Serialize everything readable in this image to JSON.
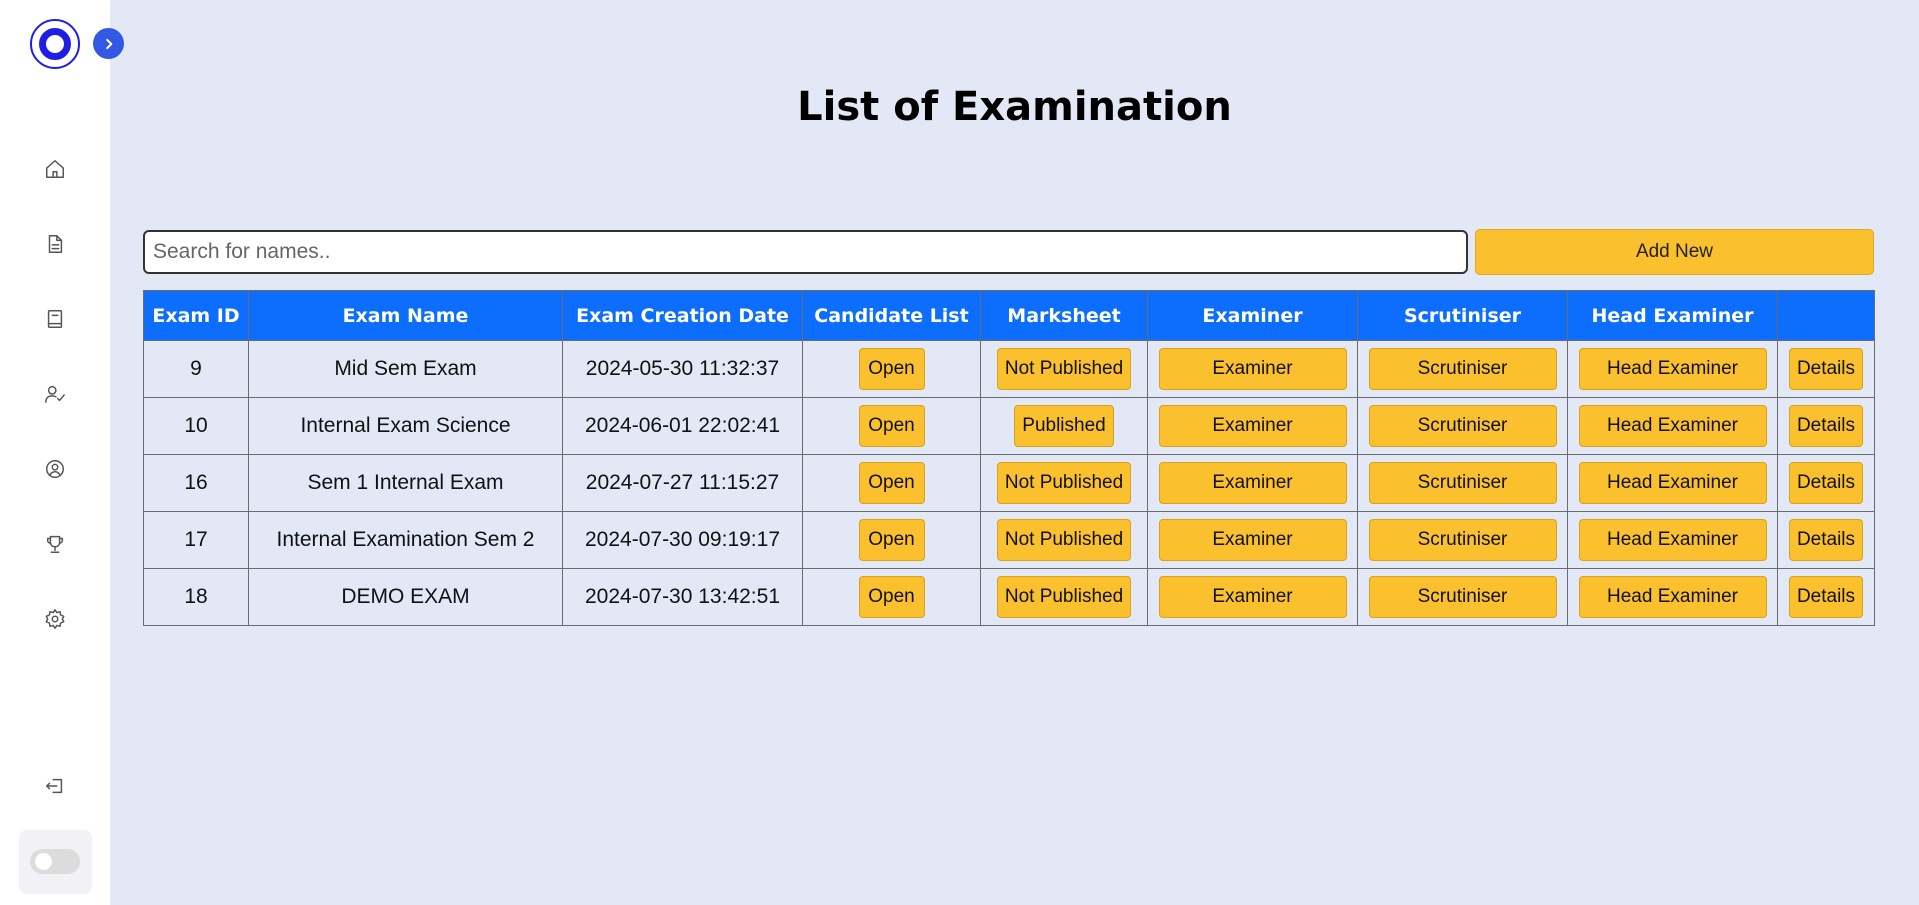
{
  "page": {
    "title": "List of Examination"
  },
  "search": {
    "placeholder": "Search for names..",
    "value": ""
  },
  "toolbar": {
    "add_new_label": "Add New"
  },
  "sidebar": {
    "items": [
      {
        "name": "home-icon"
      },
      {
        "name": "document-icon"
      },
      {
        "name": "book-icon"
      },
      {
        "name": "user-check-icon"
      },
      {
        "name": "user-circle-icon"
      },
      {
        "name": "trophy-icon"
      },
      {
        "name": "gear-icon"
      },
      {
        "name": "logout-icon"
      }
    ]
  },
  "table": {
    "headers": [
      "Exam ID",
      "Exam Name",
      "Exam Creation Date",
      "Candidate List",
      "Marksheet",
      "Examiner",
      "Scrutiniser",
      "Head Examiner",
      ""
    ],
    "rows": [
      {
        "id": "9",
        "name": "Mid Sem Exam",
        "date": "2024-05-30 11:32:37",
        "candidate": "Open",
        "marksheet": "Not Published",
        "examiner": "Examiner",
        "scrutiniser": "Scrutiniser",
        "head_examiner": "Head Examiner",
        "details": "Details"
      },
      {
        "id": "10",
        "name": "Internal Exam Science",
        "date": "2024-06-01 22:02:41",
        "candidate": "Open",
        "marksheet": "Published",
        "examiner": "Examiner",
        "scrutiniser": "Scrutiniser",
        "head_examiner": "Head Examiner",
        "details": "Details"
      },
      {
        "id": "16",
        "name": "Sem 1 Internal Exam",
        "date": "2024-07-27 11:15:27",
        "candidate": "Open",
        "marksheet": "Not Published",
        "examiner": "Examiner",
        "scrutiniser": "Scrutiniser",
        "head_examiner": "Head Examiner",
        "details": "Details"
      },
      {
        "id": "17",
        "name": "Internal Examination Sem 2",
        "date": "2024-07-30 09:19:17",
        "candidate": "Open",
        "marksheet": "Not Published",
        "examiner": "Examiner",
        "scrutiniser": "Scrutiniser",
        "head_examiner": "Head Examiner",
        "details": "Details"
      },
      {
        "id": "18",
        "name": "DEMO EXAM",
        "date": "2024-07-30 13:42:51",
        "candidate": "Open",
        "marksheet": "Not Published",
        "examiner": "Examiner",
        "scrutiniser": "Scrutiniser",
        "head_examiner": "Head Examiner",
        "details": "Details"
      }
    ]
  },
  "colors": {
    "accent": "#0d6efd",
    "button": "#fbc02d",
    "background": "#e2e8f5",
    "logo": "#1e1ee6",
    "expand_button": "#3358e6"
  }
}
